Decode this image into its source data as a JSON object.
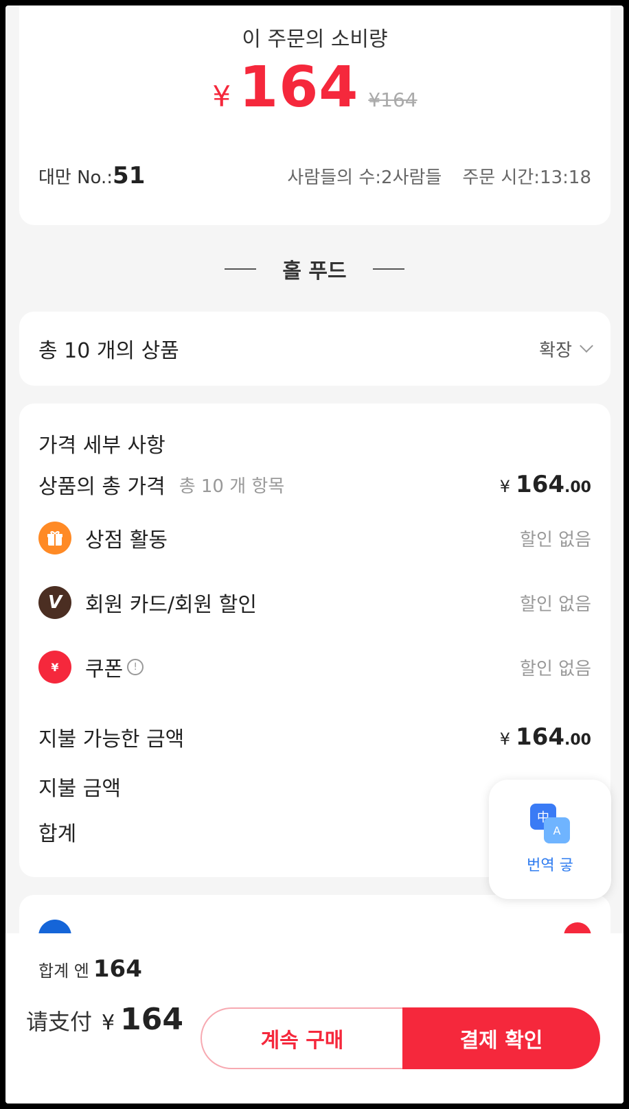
{
  "summary": {
    "title": "이 주문의 소비량",
    "currency": "¥",
    "amount": "164",
    "original_price": "¥164",
    "table_label": "대만 No.:",
    "table_number": "51",
    "people": "사람들의 수:2사람들",
    "order_time": "주문 시간:13:18"
  },
  "section_title": "홀 푸드",
  "items": {
    "count_text": "총 10 개의 상품",
    "expand_label": "확장"
  },
  "details": {
    "header": "가격 세부 사항",
    "goods_total_label": "상품의 총 가격",
    "goods_total_sub": "총 10 개 항목",
    "goods_total_currency": "¥",
    "goods_total_int": "164",
    "goods_total_dec": ".00",
    "store_activity_label": "상점 활동",
    "store_activity_value": "할인 없음",
    "member_label": "회원 카드/회원 할인",
    "member_value": "할인 없음",
    "coupon_label": "쿠폰",
    "coupon_value": "할인 없음",
    "payable_label": "지불 가능한 금액",
    "payable_currency": "¥",
    "payable_int": "164",
    "payable_dec": ".00",
    "paid_label": "지불 금액",
    "sum_label": "합계"
  },
  "translate": {
    "label": "번역 긓",
    "icon_a": "中",
    "icon_b": "A"
  },
  "icons": {
    "gift": "gift-icon",
    "member": "vip-icon",
    "coupon": "coupon-icon",
    "coupon_glyph": "¥",
    "member_glyph": "V",
    "info_glyph": "!"
  },
  "bottom": {
    "total_label": "합계 엔",
    "total_value": "164",
    "pay_label": "请支付",
    "pay_currency": "¥",
    "pay_value": "164",
    "continue_label": "계속 구매",
    "confirm_label": "결제 확인"
  },
  "colors": {
    "accent": "#f5283c",
    "translate_blue": "#2f7cf0"
  }
}
